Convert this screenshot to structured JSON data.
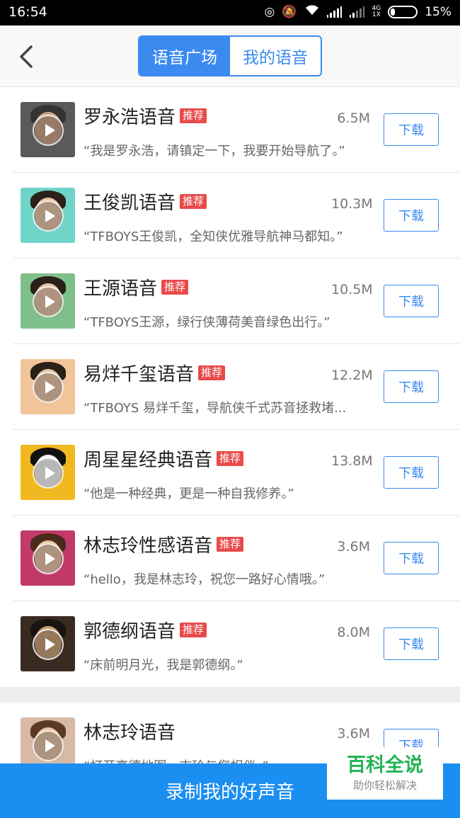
{
  "status_bar": {
    "time": "16:54",
    "network": "4G",
    "network_sub": "1X",
    "battery": "15%"
  },
  "header": {
    "back_icon": "chevron-left-icon",
    "tabs": [
      {
        "label": "语音广场",
        "active": true
      },
      {
        "label": "我的语音",
        "active": false
      }
    ]
  },
  "voices": [
    {
      "name": "罗永浩语音",
      "badge": "推荐",
      "size": "6.5M",
      "quote": "“我是罗永浩，请镇定一下，我要开始导航了。”",
      "action": "下载",
      "avatar_bg": "#5a5a5a"
    },
    {
      "name": "王俊凯语音",
      "badge": "推荐",
      "size": "10.3M",
      "quote": "“TFBOYS王俊凯，全知侠优雅导航神马都知。”",
      "action": "下载",
      "avatar_bg": "#6fd4c8"
    },
    {
      "name": "王源语音",
      "badge": "推荐",
      "size": "10.5M",
      "quote": "“TFBOYS王源，绿行侠薄荷美音绿色出行。”",
      "action": "下载",
      "avatar_bg": "#7fc08a"
    },
    {
      "name": "易烊千玺语音",
      "badge": "推荐",
      "size": "12.2M",
      "quote": "“TFBOYS 易烊千玺，导航侠千式苏音拯救堵...",
      "action": "下载",
      "avatar_bg": "#f2c49a"
    },
    {
      "name": "周星星经典语音",
      "badge": "推荐",
      "size": "13.8M",
      "quote": "“他是一种经典，更是一种自我修养。”",
      "action": "下载",
      "avatar_bg": "#f2b820"
    },
    {
      "name": "林志玲性感语音",
      "badge": "推荐",
      "size": "3.6M",
      "quote": "“hello，我是林志玲，祝您一路好心情哦。”",
      "action": "下载",
      "avatar_bg": "#c23a6a"
    },
    {
      "name": "郭德纲语音",
      "badge": "推荐",
      "size": "8.0M",
      "quote": "“床前明月光，我是郭德纲。”",
      "action": "下载",
      "avatar_bg": "#3a2a22"
    },
    {
      "name": "林志玲语音",
      "badge": "",
      "size": "3.6M",
      "quote": "“打开高德地图，志玲与您相伴。”",
      "action": "下载",
      "avatar_bg": "#d7b9a6"
    }
  ],
  "bottom": {
    "record_label": "录制我的好声音"
  },
  "watermark": {
    "title": "百科全说",
    "subtitle": "助你轻松解决"
  },
  "colors": {
    "accent": "#3b8af0",
    "badge": "#e84a4a",
    "bottom_bar": "#1b8ef2"
  }
}
